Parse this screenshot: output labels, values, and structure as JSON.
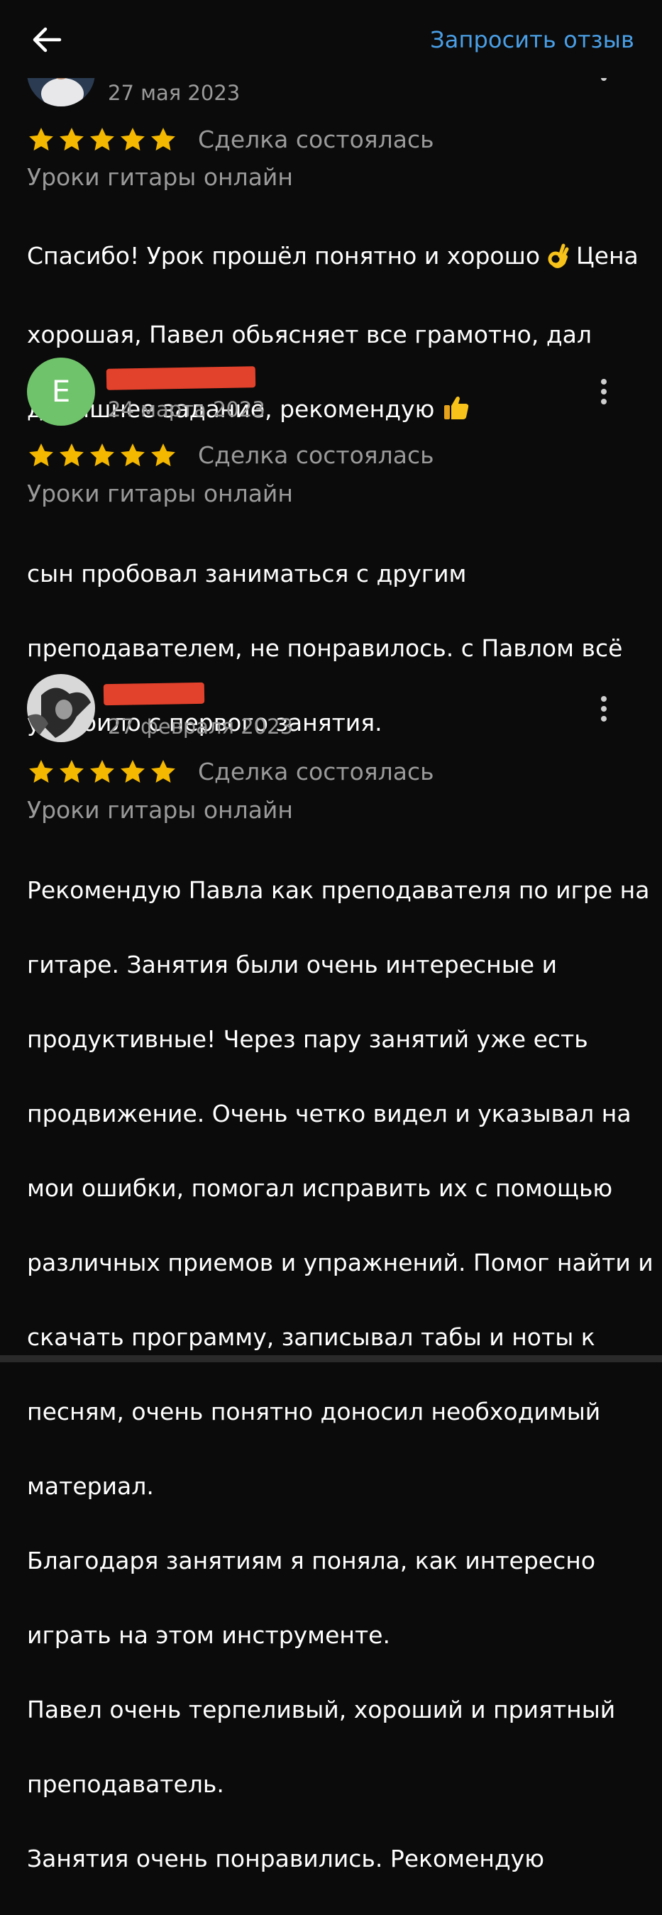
{
  "topbar": {
    "back_icon": "arrow-left-icon",
    "request_label": "Запросить отзыв",
    "accent_color": "#4a9fe6"
  },
  "reviews": [
    {
      "date": "27 мая 2023",
      "rating": 5,
      "deal_status": "Сделка состоялась",
      "service": "Уроки гитары онлайн",
      "text_lines": [
        "Спасибо! Урок прошёл понятно и хорошо",
        "Цена",
        "хорошая, Павел обьясняет все грамотно, дал",
        "домашнее задание, рекомендую"
      ]
    },
    {
      "avatar_letter": "E",
      "avatar_color": "#6fc36a",
      "date": "24 марта 2023",
      "rating": 5,
      "deal_status": "Сделка состоялась",
      "service": "Уроки гитары онлайн",
      "text_lines": [
        "сын пробовал заниматься с другим",
        "преподавателем, не понравилось. с Павлом всё",
        "устроило с первого занятия."
      ]
    },
    {
      "date": "27 февраля 2023",
      "rating": 5,
      "deal_status": "Сделка состоялась",
      "service": "Уроки гитары онлайн",
      "text_lines": [
        "Рекомендую Павла как преподавателя по игре на",
        "гитаре. Занятия были очень интересные и",
        "продуктивные! Через пару занятий уже есть",
        "продвижение. Очень четко видел и указывал на",
        "мои ошибки, помогал исправить их с помощью",
        "различных приемов и упражнений. Помог найти и",
        "скачать программу, записывал табы и ноты к",
        "песням, очень понятно доносил необходимый",
        "материал.",
        "Благодаря занятиям я  поняла, как интересно",
        "играть на этом инструменте.",
        "Павел очень терпеливый, хороший и приятный",
        "преподаватель.",
        "Занятия очень понравились. Рекомендую"
      ]
    }
  ],
  "colors": {
    "background": "#0b0b0b",
    "star": "#f5b800",
    "muted_text": "#9a9a9a",
    "redaction": "#e2412b"
  }
}
